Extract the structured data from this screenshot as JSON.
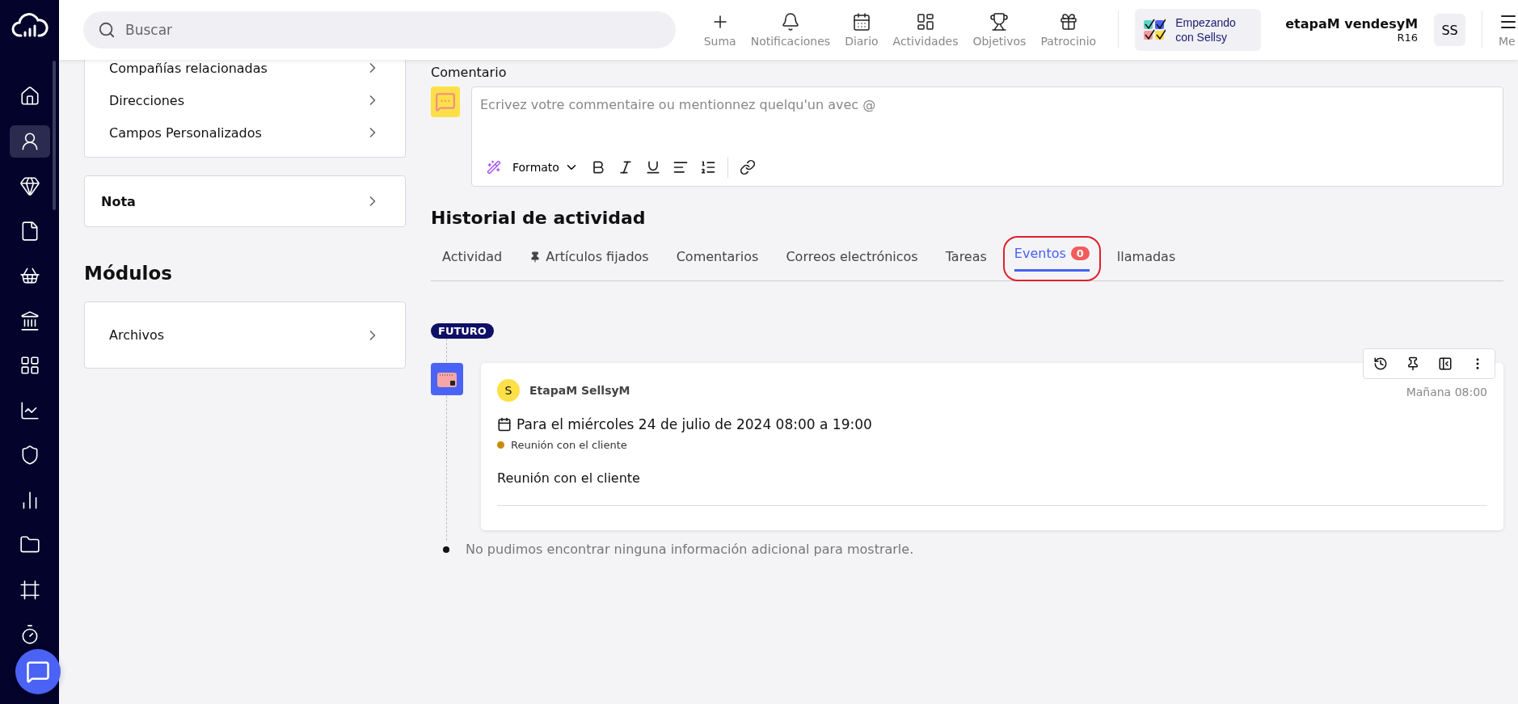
{
  "rail": {
    "items": [
      {
        "kind": "home",
        "selected": false
      },
      {
        "kind": "contacts",
        "selected": true
      },
      {
        "kind": "deals",
        "selected": false
      },
      {
        "kind": "documents",
        "selected": false
      },
      {
        "kind": "shop",
        "selected": false
      },
      {
        "kind": "bank",
        "selected": false
      },
      {
        "kind": "apps",
        "selected": false
      },
      {
        "kind": "analytics",
        "selected": false
      },
      {
        "kind": "security",
        "selected": false
      },
      {
        "kind": "reports",
        "selected": false
      },
      {
        "kind": "files",
        "selected": false
      },
      {
        "kind": "stamps",
        "selected": false
      },
      {
        "kind": "timer",
        "selected": false
      }
    ]
  },
  "search": {
    "placeholder": "Buscar"
  },
  "toolbar": [
    {
      "kind": "add",
      "label": "Suma"
    },
    {
      "kind": "notifications",
      "label": "Notificaciones"
    },
    {
      "kind": "calendar",
      "label": "Diario"
    },
    {
      "kind": "activities",
      "label": "Actividades"
    },
    {
      "kind": "goals",
      "label": "Objetivos"
    },
    {
      "kind": "gift",
      "label": "Patrocinio"
    }
  ],
  "onboarding": {
    "label": "Empezando con Sellsy"
  },
  "user": {
    "name": "etapaM vendesyM",
    "code": "R16",
    "initials": "SS"
  },
  "menu": {
    "label": "Me"
  },
  "left": {
    "details": [
      "Compañías relacionadas",
      "Direcciones",
      "Campos Personalizados"
    ],
    "note": "Nota",
    "modules_title": "Módulos",
    "modules": [
      "Archivos"
    ]
  },
  "comment": {
    "title": "Comentario",
    "placeholder": "Ecrivez votre commentaire ou mentionnez quelqu'un avec @",
    "format_label": "Formato"
  },
  "history": {
    "title": "Historial de actividad",
    "tabs": [
      {
        "label": "Actividad",
        "selected": false,
        "pinned": false,
        "highlighted": false
      },
      {
        "label": "Artículos fijados",
        "selected": false,
        "pinned": true,
        "highlighted": false
      },
      {
        "label": "Comentarios",
        "selected": false,
        "pinned": false,
        "highlighted": false
      },
      {
        "label": "Correos electrónicos",
        "selected": false,
        "pinned": false,
        "highlighted": false
      },
      {
        "label": "Tareas",
        "selected": false,
        "pinned": false,
        "highlighted": false
      },
      {
        "label": "Eventos",
        "selected": true,
        "pinned": false,
        "highlighted": true,
        "count": "0"
      },
      {
        "label": "llamadas",
        "selected": false,
        "pinned": false,
        "highlighted": false
      }
    ]
  },
  "timeline": {
    "group_label": "FUTURO",
    "events": [
      {
        "author_initial": "S",
        "author": "EtapaM SellsyM",
        "time": "Mañana 08:00",
        "schedule": "Para el miércoles 24 de julio de 2024 08:00 a 19:00",
        "tag": {
          "label": "Reunión con el cliente",
          "color": "#c98a0c"
        },
        "title": "Reunión con el cliente"
      }
    ],
    "empty_message": "No pudimos encontrar ninguna información adicional para mostrarle."
  }
}
